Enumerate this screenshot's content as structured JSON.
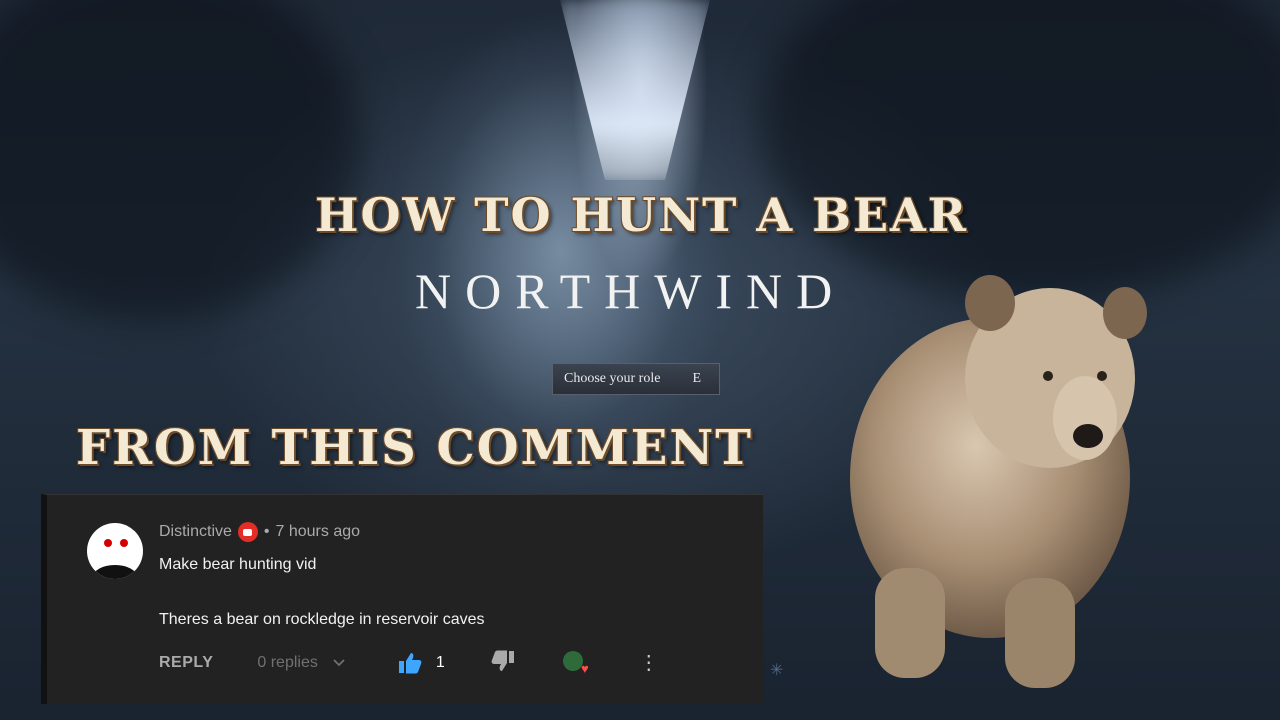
{
  "thumbnail": {
    "headline": "HOW TO HUNT A BEAR",
    "logo": "NORTHWIND",
    "role_button": {
      "label": "Choose your role",
      "key": "E"
    },
    "subheadline": "FROM THIS COMMENT"
  },
  "comment": {
    "author": "Distinctive",
    "separator": "•",
    "time": "7 hours ago",
    "lines": [
      "Make bear hunting vid",
      "Theres a bear on rockledge in reservoir caves"
    ],
    "reply_label": "REPLY",
    "replies_label": "0 replies",
    "like_count": "1",
    "icons": {
      "badge": "member-badge-icon",
      "replies_toggle": "chevron-down-icon",
      "like": "thumbs-up-icon",
      "dislike": "thumbs-down-icon",
      "creator_heart": "creator-heart-icon",
      "more": "more-vert-icon"
    },
    "colors": {
      "like_active": "#3ea6ff",
      "badge": "#e52d27",
      "heart": "#ff4e45"
    }
  }
}
